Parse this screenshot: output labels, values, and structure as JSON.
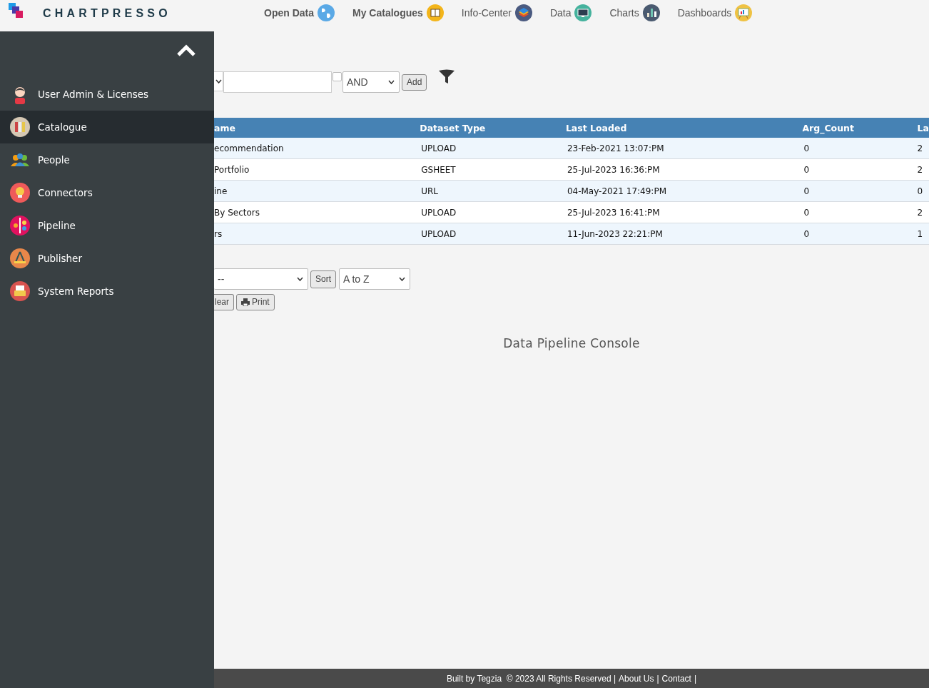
{
  "header": {
    "logo": "CHARTPRESSO",
    "nav": [
      {
        "label": "Open Data",
        "bold": true
      },
      {
        "label": "My Catalogues",
        "bold": true
      },
      {
        "label": "Info-Center",
        "bold": false
      },
      {
        "label": "Data",
        "bold": false
      },
      {
        "label": "Charts",
        "bold": false
      },
      {
        "label": "Dashboards",
        "bold": false
      }
    ]
  },
  "sidebar": {
    "items": [
      {
        "label": "User Admin & Licenses",
        "selected": false
      },
      {
        "label": "Catalogue",
        "selected": true
      },
      {
        "label": "People",
        "selected": false
      },
      {
        "label": "Connectors",
        "selected": false
      },
      {
        "label": "Pipeline",
        "selected": false
      },
      {
        "label": "Publisher",
        "selected": false
      },
      {
        "label": "System Reports",
        "selected": false
      }
    ]
  },
  "filter": {
    "operator": "AND",
    "checked": false,
    "add": "Add"
  },
  "table": {
    "columns": [
      "ame",
      "Dataset Type",
      "Last Loaded",
      "Arg_Count",
      "La"
    ],
    "rows": [
      [
        "ecommendation",
        "UPLOAD",
        "23-Feb-2021 13:07:PM",
        "0",
        "2"
      ],
      [
        "Portfolio",
        "GSHEET",
        "25-Jul-2023 16:36:PM",
        "0",
        "2"
      ],
      [
        "ine",
        "URL",
        "04-May-2021 17:49:PM",
        "0",
        "0"
      ],
      [
        "By Sectors",
        "UPLOAD",
        "25-Jul-2023 16:41:PM",
        "0",
        "2"
      ],
      [
        "rs",
        "UPLOAD",
        "11-Jun-2023 22:21:PM",
        "0",
        "1"
      ]
    ]
  },
  "sort": {
    "field": "--",
    "button": "Sort",
    "order": "A to Z"
  },
  "actions": {
    "clear": "lear",
    "print": "Print"
  },
  "console_title": "Data Pipeline Console",
  "footer": {
    "text": "Built by Tegzia  © 2023 All Rights Reserved |",
    "links": [
      "About Us",
      "Contact"
    ],
    "sep": "|"
  }
}
